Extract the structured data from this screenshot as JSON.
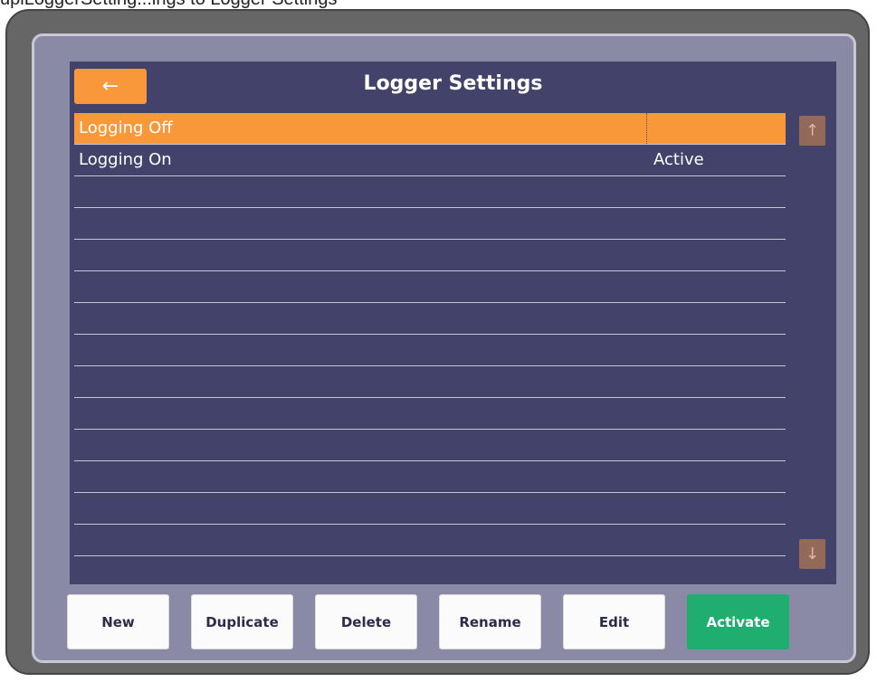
{
  "caption": "uplLoggerSetting...ings to Logger Settings",
  "header": {
    "title": "Logger Settings",
    "back_label": "←"
  },
  "list": {
    "items": [
      {
        "name": "Logging Off",
        "status": "",
        "selected": true
      },
      {
        "name": "Logging On",
        "status": "Active",
        "selected": false
      },
      {
        "name": "",
        "status": ""
      },
      {
        "name": "",
        "status": ""
      },
      {
        "name": "",
        "status": ""
      },
      {
        "name": "",
        "status": ""
      },
      {
        "name": "",
        "status": ""
      },
      {
        "name": "",
        "status": ""
      },
      {
        "name": "",
        "status": ""
      },
      {
        "name": "",
        "status": ""
      },
      {
        "name": "",
        "status": ""
      },
      {
        "name": "",
        "status": ""
      },
      {
        "name": "",
        "status": ""
      },
      {
        "name": "",
        "status": ""
      }
    ]
  },
  "scroll": {
    "up_label": "↑",
    "down_label": "↓"
  },
  "actions": {
    "new_label": "New",
    "duplicate_label": "Duplicate",
    "delete_label": "Delete",
    "rename_label": "Rename",
    "edit_label": "Edit",
    "activate_label": "Activate"
  },
  "colors": {
    "panel_bg": "#42426a",
    "accent_orange": "#f8983a",
    "activate_green": "#1fae70",
    "scroll_disabled": "#93695a"
  }
}
